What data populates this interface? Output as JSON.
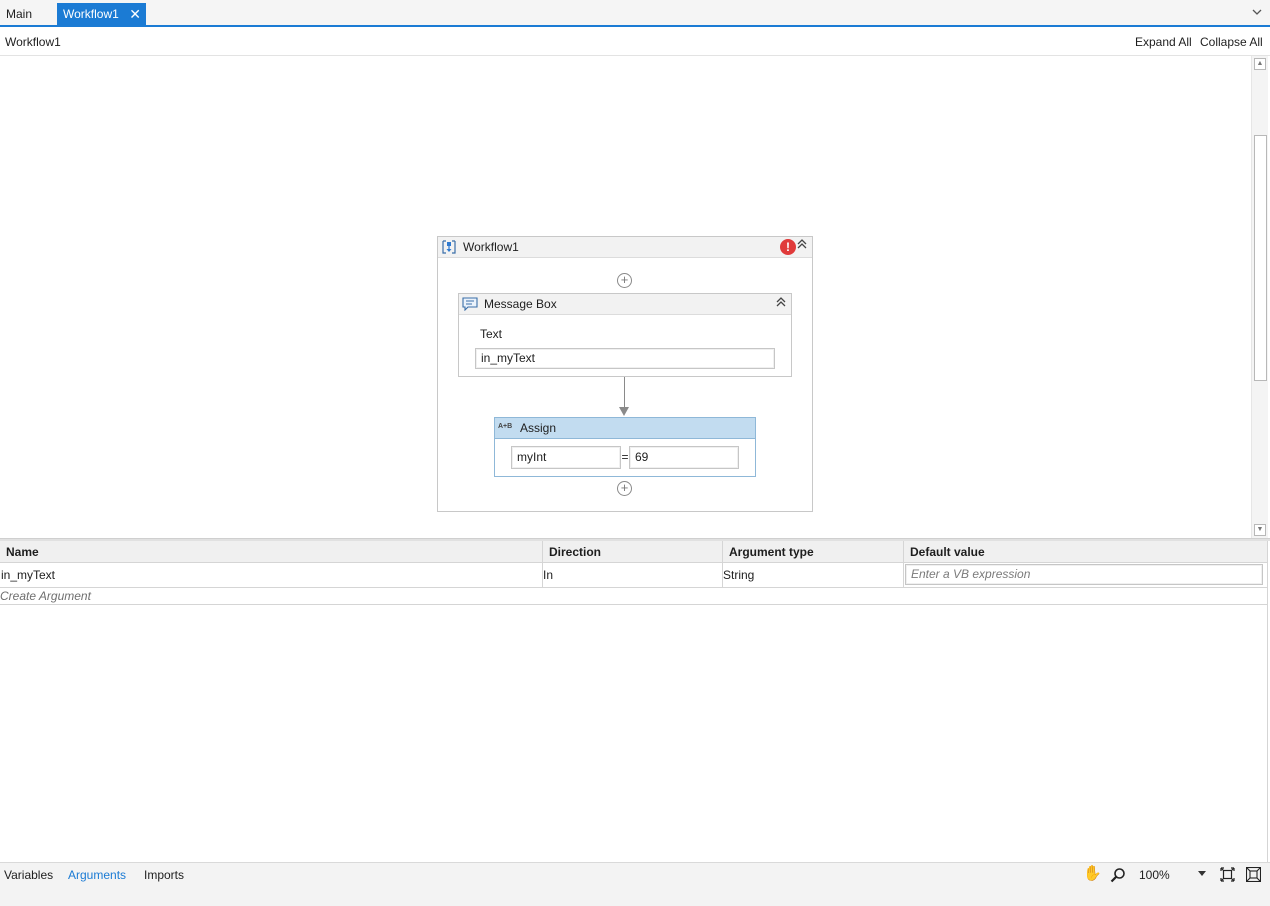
{
  "tabs": [
    {
      "label": "Main",
      "active": false
    },
    {
      "label": "Workflow1",
      "active": true
    }
  ],
  "breadcrumb": "Workflow1",
  "toolbar": {
    "expand_all": "Expand All",
    "collapse_all": "Collapse All"
  },
  "designer": {
    "sequence": {
      "title": "Workflow1",
      "has_error": true,
      "icons": [
        "sequence-icon",
        "error-icon",
        "collapse-icon"
      ]
    },
    "message_box": {
      "title": "Message Box",
      "text_label": "Text",
      "text_value": "in_myText"
    },
    "assign": {
      "title": "Assign",
      "icon_text": "A+B",
      "to": "myInt",
      "equals": "=",
      "value": "69"
    }
  },
  "arguments_grid": {
    "columns": [
      "Name",
      "Direction",
      "Argument type",
      "Default value"
    ],
    "rows": [
      {
        "name": "in_myText",
        "direction": "In",
        "type": "String",
        "default_placeholder": "Enter a VB expression"
      }
    ],
    "create_label": "Create Argument"
  },
  "bottom_tabs": [
    "Variables",
    "Arguments",
    "Imports"
  ],
  "active_bottom_tab": "Arguments",
  "zoom": "100%",
  "colors": {
    "accent": "#1b7bd4",
    "assign_header": "#c2dcf0",
    "error": "#e03a3a"
  }
}
